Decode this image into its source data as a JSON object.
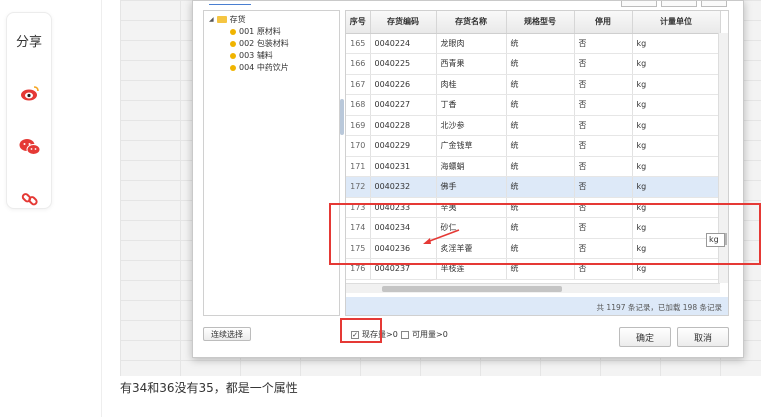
{
  "share": {
    "label": "分享",
    "icons": [
      "weibo-icon",
      "wechat-icon",
      "link-icon"
    ]
  },
  "tree": {
    "root": "存货",
    "items": [
      "001 原材料",
      "002 包装材料",
      "003 辅料",
      "004 中药饮片"
    ]
  },
  "table": {
    "headers": [
      "序号",
      "存货编码",
      "存货名称",
      "规格型号",
      "停用",
      "计量单位"
    ],
    "rows": [
      [
        "165",
        "0040224",
        "龙眼肉",
        "统",
        "否",
        "kg"
      ],
      [
        "166",
        "0040225",
        "西青果",
        "统",
        "否",
        "kg"
      ],
      [
        "167",
        "0040226",
        "肉桂",
        "统",
        "否",
        "kg"
      ],
      [
        "168",
        "0040227",
        "丁香",
        "统",
        "否",
        "kg"
      ],
      [
        "169",
        "0040228",
        "北沙参",
        "统",
        "否",
        "kg"
      ],
      [
        "170",
        "0040229",
        "广金钱草",
        "统",
        "否",
        "kg"
      ],
      [
        "171",
        "0040231",
        "海螵蛸",
        "统",
        "否",
        "kg"
      ],
      [
        "172",
        "0040232",
        "佛手",
        "统",
        "否",
        "kg"
      ],
      [
        "173",
        "0040233",
        "辛夷",
        "统",
        "否",
        "kg"
      ],
      [
        "174",
        "0040234",
        "砂仁",
        "统",
        "否",
        "kg"
      ],
      [
        "175",
        "0040236",
        "炙淫羊藿",
        "统",
        "否",
        "kg"
      ],
      [
        "176",
        "0040237",
        "半枝莲",
        "统",
        "否",
        "kg"
      ]
    ],
    "selected_row": "172",
    "status": "共 1197 条记录，已加载 198 条记录",
    "tooltip": "kg"
  },
  "buttons": {
    "continuous_select": "连续选择",
    "confirm": "确定",
    "cancel": "取消"
  },
  "filters": {
    "stock_label": "现存量>0",
    "stock_checked": true,
    "available_label": "可用量>0",
    "available_checked": false
  },
  "caption": "有34和36没有35，都是一个属性",
  "colors": {
    "highlight": "#e53935",
    "selected_row": "#dde9f8"
  }
}
